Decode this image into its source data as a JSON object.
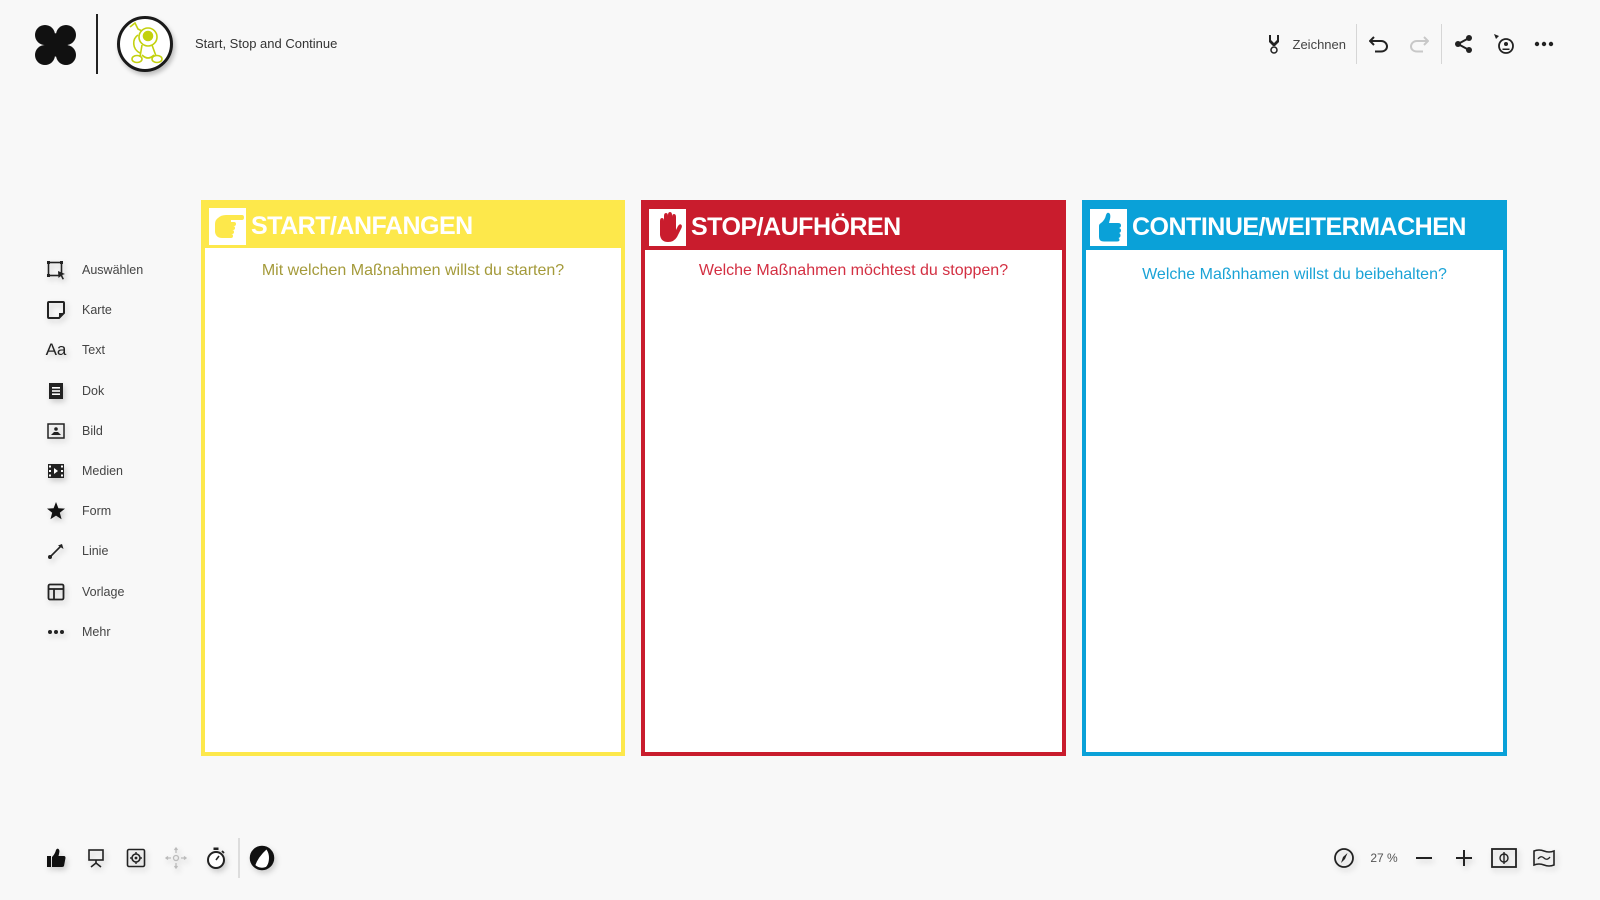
{
  "header": {
    "board_title": "Start, Stop and Continue",
    "draw_label": "Zeichnen",
    "actions": [
      {
        "name": "undo",
        "icon": "undo-icon"
      },
      {
        "name": "redo",
        "icon": "redo-icon",
        "disabled": true
      },
      {
        "name": "share",
        "icon": "share-icon"
      },
      {
        "name": "follow-presenter",
        "icon": "presenter-pointer-icon"
      },
      {
        "name": "more",
        "icon": "more-horizontal-icon"
      }
    ]
  },
  "tools": [
    {
      "label": "Auswählen",
      "icon": "select-icon"
    },
    {
      "label": "Karte",
      "icon": "card-icon"
    },
    {
      "label": "Text",
      "icon": "text-icon",
      "glyph": "Aa"
    },
    {
      "label": "Dok",
      "icon": "document-icon"
    },
    {
      "label": "Bild",
      "icon": "image-icon"
    },
    {
      "label": "Medien",
      "icon": "media-icon"
    },
    {
      "label": "Form",
      "icon": "star-icon"
    },
    {
      "label": "Linie",
      "icon": "line-icon"
    },
    {
      "label": "Vorlage",
      "icon": "template-icon"
    },
    {
      "label": "Mehr",
      "icon": "more-icon"
    }
  ],
  "columns": [
    {
      "title": "START/ANFANGEN",
      "question": "Mit welchen Maßnahmen willst du starten?",
      "icon": "pointing-hand-icon",
      "color": "#fde84b",
      "text_color": "#a49a3a"
    },
    {
      "title": "STOP/AUFHÖREN",
      "question": "Welche Maßnahmen möchtest du stoppen?",
      "icon": "stop-hand-icon",
      "color": "#c91c2d",
      "text_color": "#d32f42"
    },
    {
      "title": "CONTINUE/WEITERMACHEN",
      "question": "Welche Maßnhamen willst du beibehalten?",
      "icon": "thumbs-up-icon",
      "color": "#0aa1d8",
      "text_color": "#1aa3d6"
    }
  ],
  "bottom_left": [
    {
      "name": "vote",
      "icon": "thumbs-up-icon"
    },
    {
      "name": "presentation",
      "icon": "presentation-icon"
    },
    {
      "name": "focus",
      "icon": "focus-icon"
    },
    {
      "name": "attention",
      "icon": "attention-icon",
      "disabled": true
    },
    {
      "name": "timer",
      "icon": "stopwatch-icon"
    },
    {
      "name": "theme",
      "icon": "contrast-icon"
    }
  ],
  "zoom": {
    "level": "27 %",
    "navigator_icon": "compass-icon",
    "zoom_out_icon": "minus-icon",
    "zoom_in_icon": "plus-icon",
    "fit_icon": "fit-to-screen-icon",
    "minimap_icon": "minimap-icon"
  }
}
